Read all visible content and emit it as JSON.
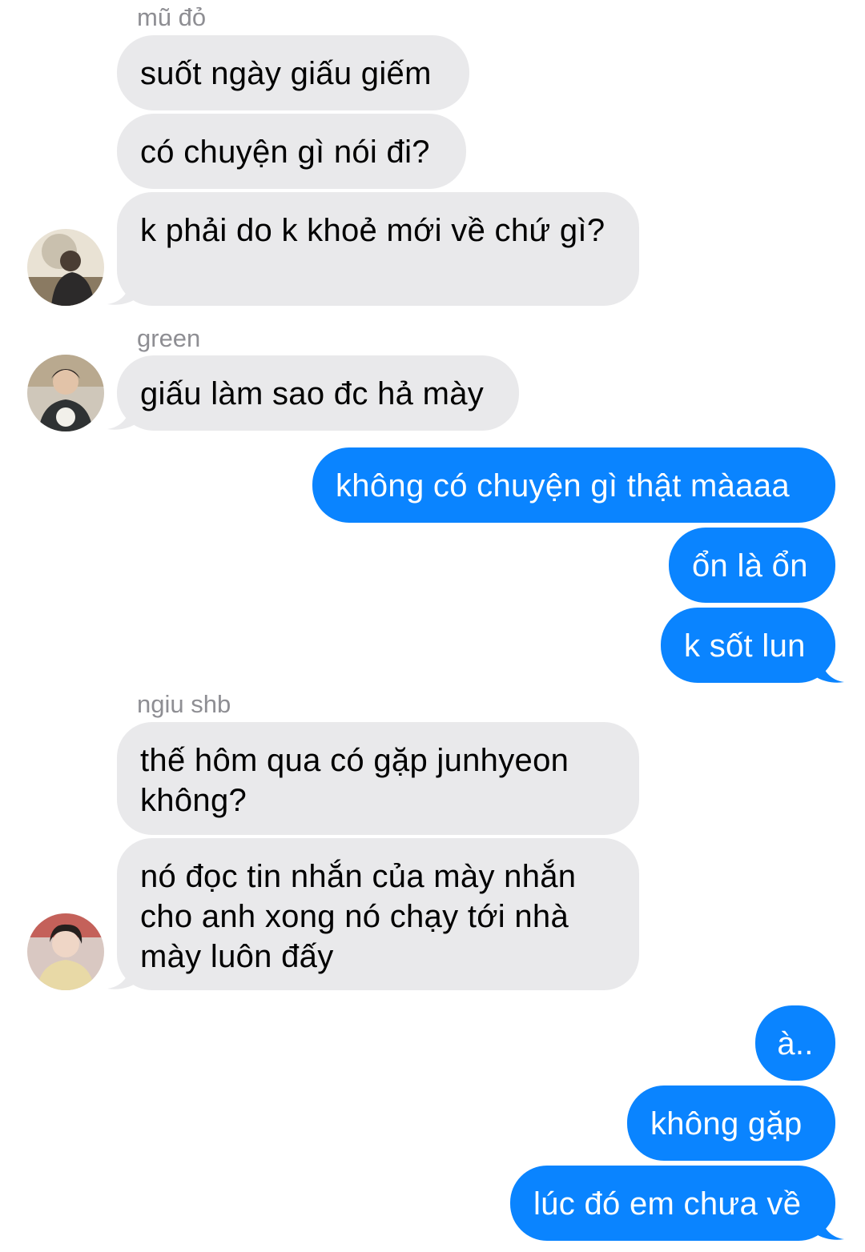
{
  "colors": {
    "incoming_bubble": "#e9e9eb",
    "outgoing_bubble": "#0a84ff",
    "sender_name": "#8e8e93"
  },
  "groups": [
    {
      "sender": "mũ đỏ",
      "avatar": "avatar-photo",
      "messages": [
        "suốt ngày giấu giếm",
        "có chuyện gì nói đi?",
        "k phải do k khoẻ mới về chứ gì?"
      ]
    },
    {
      "sender": "green",
      "avatar": "avatar-photo",
      "messages": [
        "giấu làm sao đc hả mày"
      ]
    },
    {
      "sender": "me",
      "messages": [
        "không có chuyện gì thật màaaa",
        "ổn là ổn",
        "k sốt lun"
      ]
    },
    {
      "sender": "ngiu shb",
      "avatar": "avatar-photo",
      "messages": [
        "thế hôm qua có gặp junhyeon không?",
        "nó đọc tin nhắn của mày nhắn cho anh xong nó chạy tới nhà mày luôn đấy"
      ]
    },
    {
      "sender": "me",
      "messages": [
        "à..",
        "không gặp",
        "lúc đó em chưa về"
      ]
    }
  ]
}
